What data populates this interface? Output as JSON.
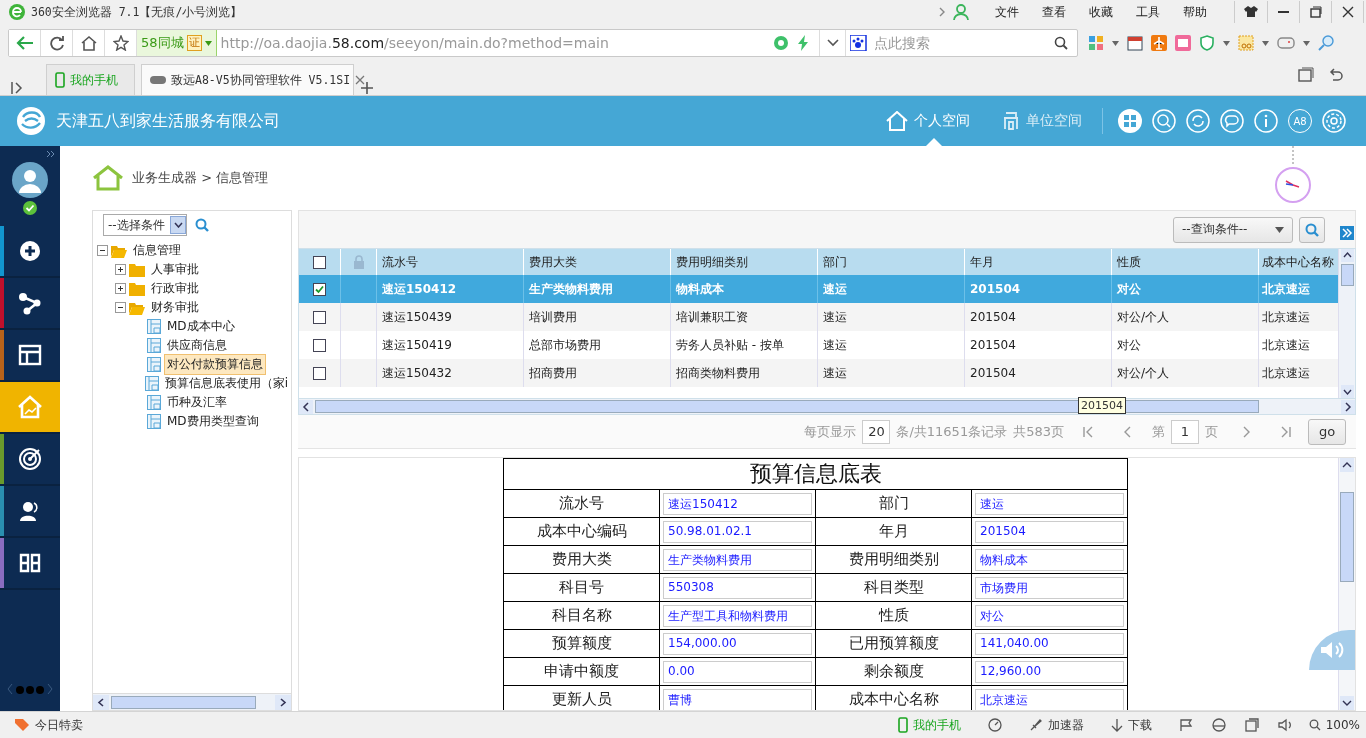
{
  "browser": {
    "title": "360安全浏览器 7.1【无痕/小号浏览】",
    "menu": [
      "文件",
      "查看",
      "收藏",
      "工具",
      "帮助"
    ],
    "site_badge": "58同城",
    "cert_badge": "证",
    "url": {
      "prefix": "http://oa.daojia.",
      "domain": "58.com",
      "path": "/seeyon/main.do?method=main"
    },
    "search": {
      "placeholder": "点此搜索"
    },
    "tabs": [
      {
        "label": "我的手机",
        "selected": false
      },
      {
        "label": "致远A8-V5协同管理软件 V5.1SI",
        "selected": true
      }
    ]
  },
  "app": {
    "company": "天津五八到家生活服务有限公司",
    "nav": [
      {
        "label": "个人空间",
        "selected": true
      },
      {
        "label": "单位空间",
        "selected": false
      }
    ],
    "version_badge": "A8"
  },
  "side_nav": {
    "items": [
      {
        "kind": "plus",
        "color": "#1296cf",
        "selected": false
      },
      {
        "kind": "share",
        "color": "#c0102c",
        "selected": false
      },
      {
        "kind": "calendar",
        "color": "#b8631a",
        "selected": false
      },
      {
        "kind": "home",
        "color": "#f0b400",
        "selected": true
      },
      {
        "kind": "target",
        "color": "#6a9a2c",
        "selected": false
      },
      {
        "kind": "person",
        "color": "#2a8fb0",
        "selected": false
      },
      {
        "kind": "columns",
        "color": "#8a6cc0",
        "selected": false
      }
    ]
  },
  "breadcrumb": "业务生成器 > 信息管理",
  "tree": {
    "filter": {
      "value": "--选择条件"
    },
    "nodes": [
      {
        "label": "信息管理",
        "kind": "folder",
        "expanded": true,
        "selected": false,
        "children": [
          {
            "label": "人事审批",
            "kind": "folder",
            "expanded": false,
            "selected": false
          },
          {
            "label": "行政审批",
            "kind": "folder",
            "expanded": false,
            "selected": false
          },
          {
            "label": "财务审批",
            "kind": "folder",
            "expanded": true,
            "selected": false,
            "children": [
              {
                "label": "MD成本中心",
                "kind": "form",
                "selected": false
              },
              {
                "label": "供应商信息",
                "kind": "form",
                "selected": false
              },
              {
                "label": "对公付款预算信息",
                "kind": "form",
                "selected": true
              },
              {
                "label": "预算信息底表使用（家i",
                "kind": "form",
                "selected": false
              },
              {
                "label": "币种及汇率",
                "kind": "form",
                "selected": false
              },
              {
                "label": "MD费用类型查询",
                "kind": "form",
                "selected": false
              }
            ]
          }
        ]
      }
    ]
  },
  "query": {
    "value": "--查询条件--"
  },
  "grid": {
    "all_checked": false,
    "columns": [
      "流水号",
      "费用大类",
      "费用明细类别",
      "部门",
      "年月",
      "性质",
      "成本中心名称"
    ],
    "rows": [
      {
        "checked": true,
        "selected": true,
        "cells": [
          "速运150412",
          "生产类物料费用",
          "物料成本",
          "速运",
          "201504",
          "对公",
          "北京速运"
        ]
      },
      {
        "checked": false,
        "selected": false,
        "cells": [
          "速运150439",
          "培训费用",
          "培训兼职工资",
          "速运",
          "201504",
          "对公/个人",
          "北京速运"
        ]
      },
      {
        "checked": false,
        "selected": false,
        "cells": [
          "速运150419",
          "总部市场费用",
          "劳务人员补贴 - 按单",
          "速运",
          "201504",
          "对公",
          "北京速运"
        ]
      },
      {
        "checked": false,
        "selected": false,
        "cells": [
          "速运150432",
          "招商费用",
          "招商类物料费用",
          "速运",
          "201504",
          "对公/个人",
          "北京速运"
        ]
      }
    ],
    "tooltip": "201504"
  },
  "pager": {
    "page_size_label": "每页显示",
    "page_size": "20",
    "records": "条/共11651条记录",
    "pages": "共583页",
    "page_prefix": "第",
    "page": "1",
    "page_suffix": "页",
    "go": "go"
  },
  "form": {
    "title": "预算信息底表",
    "fields": [
      {
        "label": "流水号",
        "value": "速运150412"
      },
      {
        "label": "部门",
        "value": "速运"
      },
      {
        "label": "成本中心编码",
        "value": "50.98.01.02.1"
      },
      {
        "label": "年月",
        "value": "201504"
      },
      {
        "label": "费用大类",
        "value": "生产类物料费用"
      },
      {
        "label": "费用明细类别",
        "value": "物料成本"
      },
      {
        "label": "科目号",
        "value": "550308"
      },
      {
        "label": "科目类型",
        "value": "市场费用"
      },
      {
        "label": "科目名称",
        "value": "生产型工具和物料费用"
      },
      {
        "label": "性质",
        "value": "对公"
      },
      {
        "label": "预算额度",
        "value": "154,000.00"
      },
      {
        "label": "已用预算额度",
        "value": "141,040.00"
      },
      {
        "label": "申请中额度",
        "value": "0.00"
      },
      {
        "label": "剩余额度",
        "value": "12,960.00"
      },
      {
        "label": "更新人员",
        "value": "曹博"
      },
      {
        "label": "成本中心名称",
        "value": "北京速运"
      }
    ]
  },
  "status_bar": {
    "left": "今日特卖",
    "phone": "我的手机",
    "accelerator": "加速器",
    "download": "下载",
    "zoom": "100%"
  }
}
